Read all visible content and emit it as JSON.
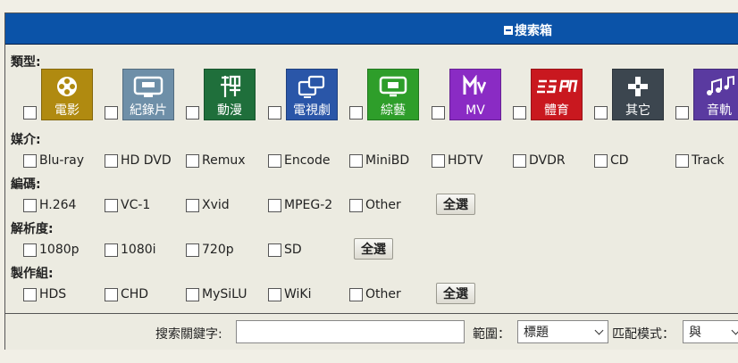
{
  "header": {
    "title": "搜索箱"
  },
  "sections": {
    "type_label": "類型:",
    "media_label": "媒介:",
    "codec_label": "編碼:",
    "resolution_label": "解析度:",
    "group_label": "製作組:"
  },
  "categories": [
    {
      "label": "電影",
      "icon": "film-reel-icon",
      "color": "#b08a10"
    },
    {
      "label": "紀錄片",
      "icon": "bbc-tv-icon",
      "color": "#6e8fa8"
    },
    {
      "label": "動漫",
      "icon": "zen-character-icon",
      "color": "#1f6f3b"
    },
    {
      "label": "電視劇",
      "icon": "tv-series-icon",
      "color": "#2a56a8"
    },
    {
      "label": "綜藝",
      "icon": "qi-tv-icon",
      "color": "#2e9e2a"
    },
    {
      "label": "MV",
      "icon": "mtv-icon",
      "color": "#8a2bc4"
    },
    {
      "label": "體育",
      "icon": "espn-icon",
      "color": "#c9181f"
    },
    {
      "label": "其它",
      "icon": "dpad-icon",
      "color": "#3c464f"
    },
    {
      "label": "音軌",
      "icon": "music-notes-icon",
      "color": "#5a3aa0"
    }
  ],
  "media": [
    "Blu-ray",
    "HD DVD",
    "Remux",
    "Encode",
    "MiniBD",
    "HDTV",
    "DVDR",
    "CD",
    "Track"
  ],
  "codecs": [
    "H.264",
    "VC-1",
    "Xvid",
    "MPEG-2",
    "Other"
  ],
  "resolutions": [
    "1080p",
    "1080i",
    "720p",
    "SD"
  ],
  "groups": [
    "HDS",
    "CHD",
    "MySiLU",
    "WiKi",
    "Other"
  ],
  "select_all_label": "全選",
  "footer": {
    "keyword_label": "搜索關鍵字:",
    "keyword_value": "",
    "scope_label": "範圍：",
    "scope_value": "標題",
    "match_label": "匹配模式：",
    "match_value": "與"
  }
}
